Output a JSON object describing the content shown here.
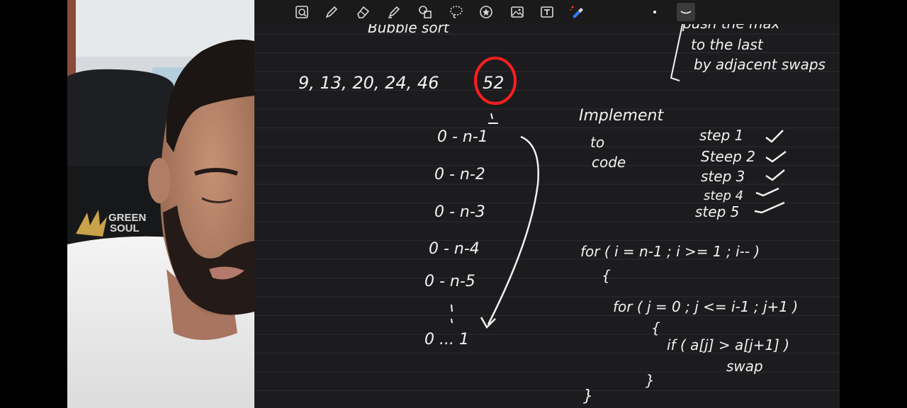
{
  "colors": {
    "canvas_bg": "#1c1c1e",
    "toolbar_bg": "#1a1a1b",
    "rule_line": "#2c2c2e",
    "ink": "#f2f2f2",
    "highlight": "#ff1e1e",
    "pen_accent": "#2f7bf6"
  },
  "toolbar": {
    "tools": [
      {
        "icon": "zoom-box-icon"
      },
      {
        "icon": "pen-icon"
      },
      {
        "icon": "eraser-icon"
      },
      {
        "icon": "highlighter-icon"
      },
      {
        "icon": "shapes-icon"
      },
      {
        "icon": "lasso-icon"
      },
      {
        "icon": "sticker-icon"
      },
      {
        "icon": "image-icon"
      },
      {
        "icon": "text-box-icon"
      },
      {
        "icon": "laser-pointer-icon"
      },
      {
        "icon": "pen-color-dot"
      },
      {
        "icon": "stroke-width-icon"
      }
    ]
  },
  "webcam": {
    "chair_logo_line1": "GREEN",
    "chair_logo_line2": "SOUL"
  },
  "notes": {
    "heading": "Bubble sort",
    "top_right_line1": "push the max",
    "top_right_line2": "to the last",
    "top_right_line3": "by adjacent swaps",
    "array_text": "9, 13, 20, 24, 46",
    "circled_value": "52",
    "passes": [
      "0 - n-1",
      "0 - n-2",
      "0 - n-3",
      "0 - n-4",
      "0 - n-5",
      "0 ... 1"
    ],
    "implement_line1": "Implement",
    "implement_line2": "to",
    "implement_line3": "code",
    "steps": [
      "step 1",
      "Steep 2",
      "step 3",
      "step 4",
      "step 5"
    ],
    "code_line1": "for ( i = n-1 ; i >= 1 ; i-- )",
    "code_line2": "{",
    "code_line3": "for ( j = 0 ; j <= i-1 ; j+1 )",
    "code_line4": "{",
    "code_line5": "if ( a[j] > a[j+1] )",
    "code_line6": "swap",
    "code_line7": "}",
    "code_line8": "}"
  }
}
